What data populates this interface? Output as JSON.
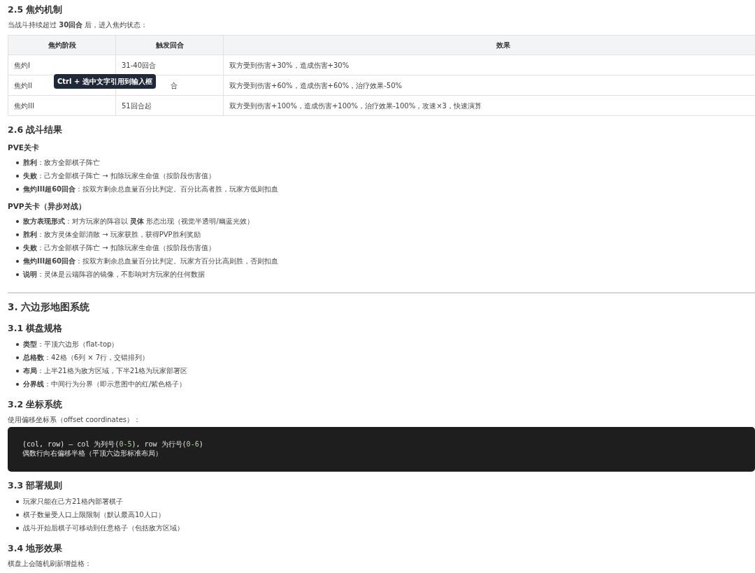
{
  "blocks": [
    {
      "kind": "h3",
      "text": "2.5 焦灼机制"
    },
    {
      "kind": "p",
      "text": "当战斗持续超过 **30回合** 后，进入焦灼状态："
    },
    {
      "kind": "table",
      "columns": [
        "焦灼阶段",
        "触发回合",
        "效果"
      ],
      "rows": [
        [
          {
            "text": "焦灼I"
          },
          {
            "text": "31-40回合"
          },
          {
            "text": "双方受到伤害+30%，造成伤害+30%"
          }
        ],
        [
          {
            "text": "焦灼II"
          },
          {
            "text": "合",
            "covered": true
          },
          {
            "text": "双方受到伤害+60%，造成伤害+60%，治疗效果-50%"
          }
        ],
        [
          {
            "text": "焦灼III"
          },
          {
            "text": "51回合起"
          },
          {
            "text": "双方受到伤害+100%，造成伤害+100%，治疗效果-100%，攻速×3，快速演算"
          }
        ]
      ],
      "tooltip": "Ctrl + 选中文字引用到输入框"
    },
    {
      "kind": "h3",
      "text": "2.6 战斗结果"
    },
    {
      "kind": "h4",
      "text": "PVE关卡"
    },
    {
      "kind": "ul",
      "items": [
        "**胜利**：敌方全部棋子阵亡",
        "**失败**：己方全部棋子阵亡 → 扣除玩家生命值（按阶段伤害值）",
        "**焦灼III超60回合**：按双方剩余总血量百分比判定。百分比高者胜，玩家方低则扣血"
      ]
    },
    {
      "kind": "h4",
      "text": "PVP关卡（异步对战）"
    },
    {
      "kind": "ul",
      "items": [
        "**敌方表现形式**：对方玩家的阵容以 **灵体** 形态出现（视觉半透明/幽蓝光效）",
        "**胜利**：敌方灵体全部消散 → 玩家获胜，获得PVP胜利奖励",
        "**失败**：己方全部棋子阵亡 → 扣除玩家生命值（按阶段伤害值）",
        "**焦灼III超60回合**：按双方剩余总血量百分比判定。玩家方百分比高则胜，否则扣血",
        "**说明**：灵体是云端阵容的镜像，不影响对方玩家的任何数据"
      ]
    },
    {
      "kind": "hr"
    },
    {
      "kind": "h2",
      "text": "3. 六边形地图系统"
    },
    {
      "kind": "h3",
      "text": "3.1 棋盘规格"
    },
    {
      "kind": "ul",
      "items": [
        "**类型**：平顶六边形（flat-top）",
        "**总格数**：42格（6列 × 7行，交错排列）",
        "**布局**：上半21格为敌方区域，下半21格为玩家部署区",
        "**分界线**：中间行为分界（即示意图中的红/紫色格子）"
      ]
    },
    {
      "kind": "h3",
      "text": "3.2 坐标系统"
    },
    {
      "kind": "p",
      "text": "使用偏移坐标系（offset coordinates）："
    },
    {
      "kind": "code",
      "lines": [
        [
          {
            "text": "(col, row) — col 为列号(",
            "kind": "plain"
          },
          {
            "text": "0-5",
            "kind": "num"
          },
          {
            "text": "), row 为行号(",
            "kind": "plain"
          },
          {
            "text": "0-6",
            "kind": "num"
          },
          {
            "text": ")",
            "kind": "plain"
          }
        ],
        [
          {
            "text": "偶数行向右偏移半格（平顶六边形标准布局）",
            "kind": "plain"
          }
        ]
      ]
    },
    {
      "kind": "h3",
      "text": "3.3 部署规则"
    },
    {
      "kind": "ul",
      "items": [
        "玩家只能在己方21格内部署棋子",
        "棋子数量受人口上限限制（默认最高10人口）",
        "战斗开始后棋子可移动到任意格子（包括敌方区域）"
      ]
    },
    {
      "kind": "h3",
      "text": "3.4 地形效果"
    },
    {
      "kind": "p",
      "text": "棋盘上会随机刷新增益格："
    }
  ]
}
